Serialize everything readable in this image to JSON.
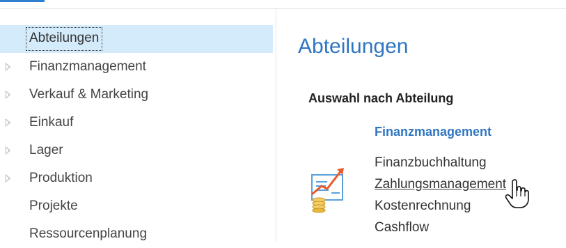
{
  "nav": {
    "items": [
      {
        "label": "Abteilungen",
        "expandable": false,
        "selected": true
      },
      {
        "label": "Finanzmanagement",
        "expandable": true,
        "selected": false
      },
      {
        "label": "Verkauf & Marketing",
        "expandable": true,
        "selected": false
      },
      {
        "label": "Einkauf",
        "expandable": true,
        "selected": false
      },
      {
        "label": "Lager",
        "expandable": true,
        "selected": false
      },
      {
        "label": "Produktion",
        "expandable": true,
        "selected": false
      },
      {
        "label": "Projekte",
        "expandable": false,
        "selected": false
      },
      {
        "label": "Ressourcenplanung",
        "expandable": false,
        "selected": false
      }
    ]
  },
  "content": {
    "title": "Abteilungen",
    "section_heading": "Auswahl nach Abteilung",
    "group": {
      "title": "Finanzmanagement",
      "icon": "finance-chart-icon",
      "links": [
        {
          "label": "Finanzbuchhaltung",
          "hovered": false
        },
        {
          "label": "Zahlungsmanagement",
          "hovered": true
        },
        {
          "label": "Kostenrechnung",
          "hovered": false
        },
        {
          "label": "Cashflow",
          "hovered": false
        }
      ]
    }
  },
  "cursor": "hand-pointer-icon",
  "colors": {
    "accent": "#2f76c0",
    "selection": "#d4ebfb",
    "icon_red": "#e85a2c",
    "icon_gold": "#e9b840",
    "icon_blue": "#5aa0dc"
  }
}
